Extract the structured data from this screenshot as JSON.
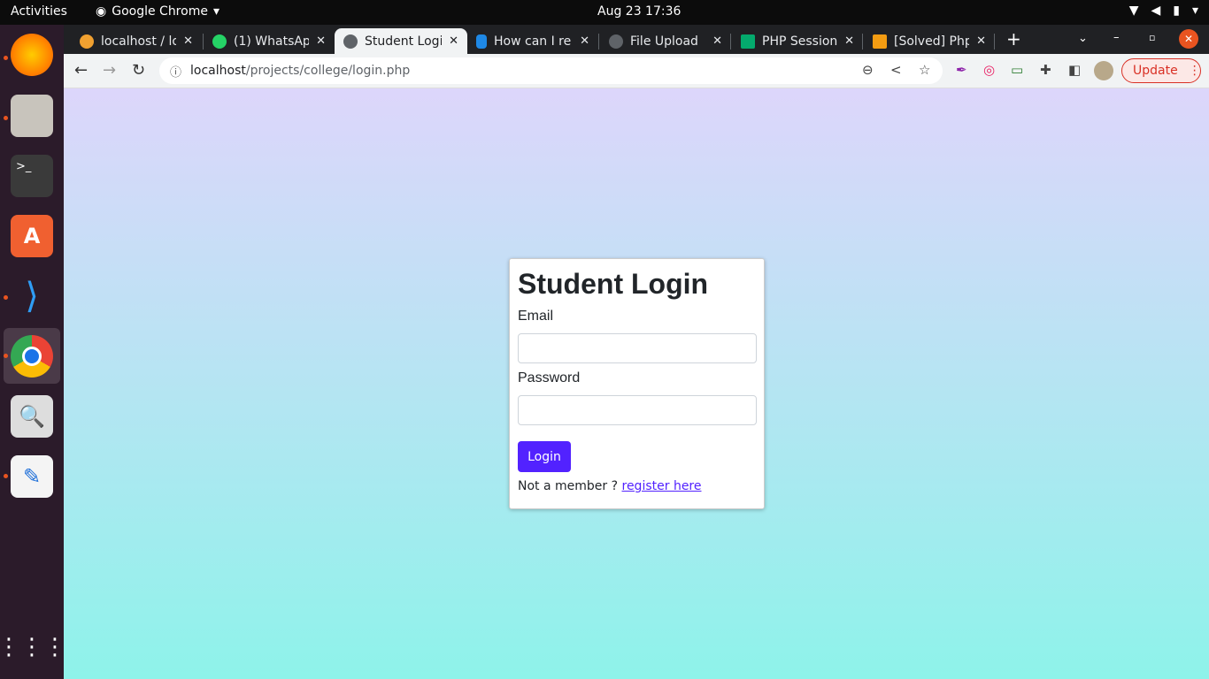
{
  "topbar": {
    "activities": "Activities",
    "app": "Google Chrome",
    "clock": "Aug 23  17:36"
  },
  "tabs": [
    {
      "title": "localhost / lo",
      "color": "#f0a030"
    },
    {
      "title": "(1) WhatsApp",
      "color": "#25d366"
    },
    {
      "title": "Student Login",
      "color": "#5f6368"
    },
    {
      "title": "How can I re",
      "color": "#1e88e5"
    },
    {
      "title": "File Upload",
      "color": "#5f6368"
    },
    {
      "title": "PHP Session",
      "color": "#04aa6d"
    },
    {
      "title": "[Solved] Php",
      "color": "#f39c12"
    }
  ],
  "address": {
    "host": "localhost",
    "path": "/projects/college/login.php"
  },
  "update_label": "Update",
  "form": {
    "title": "Student Login",
    "email_label": "Email",
    "password_label": "Password",
    "email_value": "",
    "password_value": "",
    "login_label": "Login",
    "footer_text": "Not a member ?",
    "register_link": "register here"
  },
  "colors": {
    "accent": "#5222ff",
    "bg_top": "#ddd6fb",
    "bg_bottom": "#8ef3ea"
  }
}
